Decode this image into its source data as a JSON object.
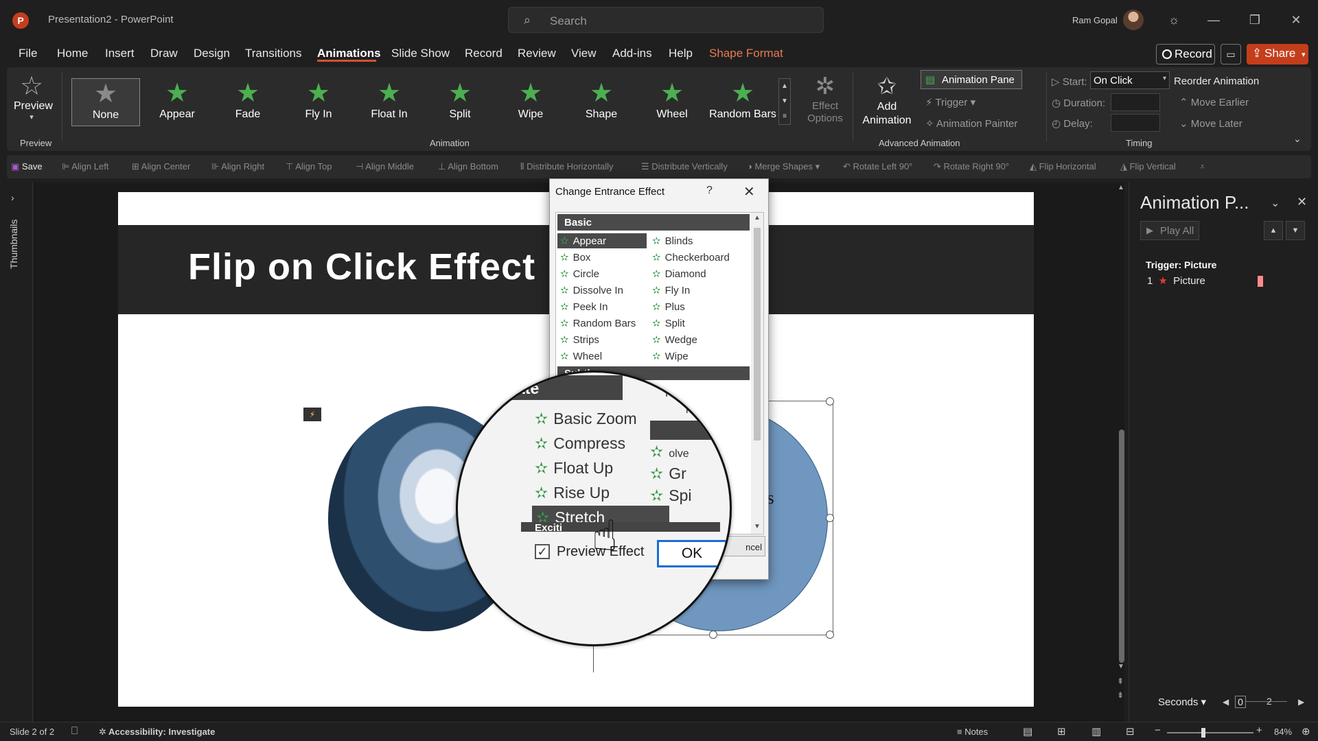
{
  "titlebar": {
    "logo_letter": "P",
    "title": "Presentation2 - PowerPoint",
    "search_placeholder": "Search",
    "user_name": "Ram Gopal"
  },
  "menu": {
    "items": [
      "File",
      "Home",
      "Insert",
      "Draw",
      "Design",
      "Transitions",
      "Animations",
      "Slide Show",
      "Record",
      "Review",
      "View",
      "Add-ins",
      "Help",
      "Shape Format"
    ],
    "active": "Animations",
    "record_label": "Record",
    "share_label": "Share"
  },
  "ribbon": {
    "preview_label": "Preview",
    "preview_group": "Preview",
    "animation_group": "Animation",
    "gallery": [
      "None",
      "Appear",
      "Fade",
      "Fly In",
      "Float In",
      "Split",
      "Wipe",
      "Shape",
      "Wheel",
      "Random Bars"
    ],
    "effect_options": "Effect Options",
    "add_animation": "Add Animation",
    "animation_pane": "Animation Pane",
    "trigger": "Trigger",
    "animation_painter": "Animation Painter",
    "advanced_group": "Advanced Animation",
    "start_label": "Start:",
    "start_value": "On Click",
    "duration_label": "Duration:",
    "delay_label": "Delay:",
    "timing_group": "Timing",
    "reorder": "Reorder Animation",
    "move_earlier": "Move Earlier",
    "move_later": "Move Later"
  },
  "quick_toolbar": [
    "Save",
    "Align Left",
    "Align Center",
    "Align Right",
    "Align Top",
    "Align Middle",
    "Align Bottom",
    "Distribute Horizontally",
    "Distribute Vertically",
    "Merge Shapes",
    "Rotate Left 90°",
    "Rotate Right 90°",
    "Flip Horizontal",
    "Flip Vertical"
  ],
  "thumbnails_label": "Thumbnails",
  "slide": {
    "title": "Flip on Click Effect",
    "blue_text_1": "this",
    "blue_text_2": "h"
  },
  "dialog": {
    "title": "Change Entrance Effect",
    "help": "?",
    "basic_header": "Basic",
    "subtle_header": "Subtle",
    "basic_left": [
      "Appear",
      "Box",
      "Circle",
      "Dissolve In",
      "Peek In",
      "Random Bars",
      "Strips",
      "Wheel"
    ],
    "basic_right": [
      "Blinds",
      "Checkerboard",
      "Diamond",
      "Fly In",
      "Plus",
      "Split",
      "Wedge",
      "Wipe"
    ],
    "ok": "OK",
    "cancel": "ncel"
  },
  "magnifier": {
    "header": "Moderate",
    "items": [
      "Basic Zoom",
      "Compress",
      "Float Up",
      "Rise Up",
      "Stretch"
    ],
    "right_items": [
      "Fade",
      "m",
      "olve",
      "Gr",
      "Spi"
    ],
    "exciting_fragment": "Exciti",
    "preview_effect": "Preview Effect",
    "ok": "OK"
  },
  "anim_pane": {
    "title": "Animation P...",
    "play_all": "Play All",
    "trigger": "Trigger: Picture",
    "item_number": "1",
    "item_name": "Picture",
    "seconds": "Seconds",
    "timeline_0": "0",
    "timeline_2": "2"
  },
  "status": {
    "slide": "Slide 2 of 2",
    "accessibility": "Accessibility: Investigate",
    "notes": "Notes",
    "zoom": "84%"
  }
}
